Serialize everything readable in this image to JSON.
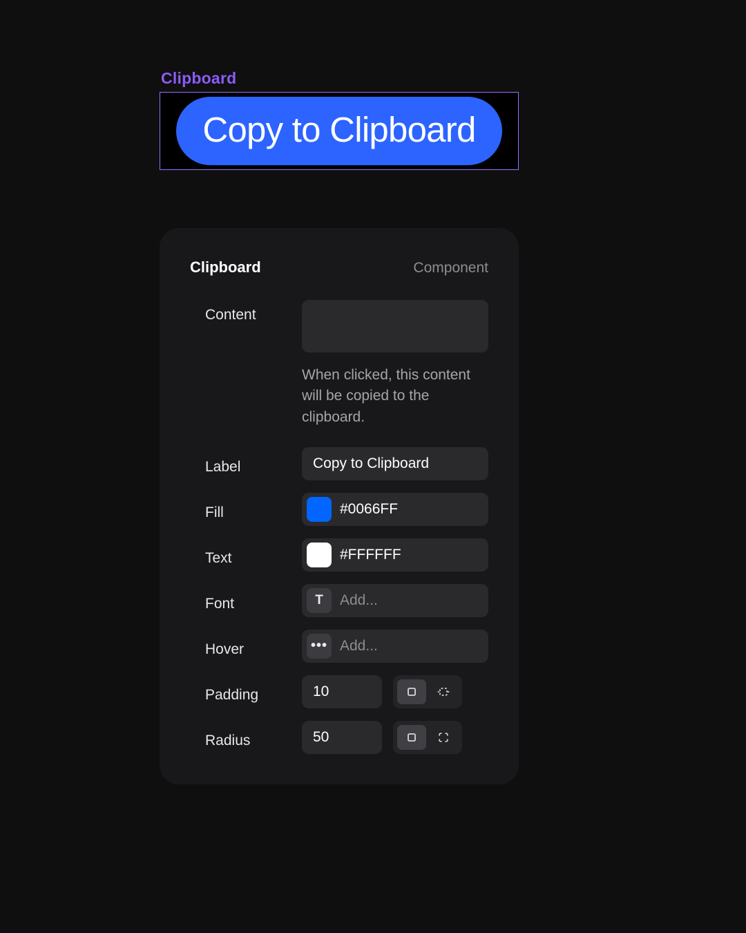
{
  "canvas": {
    "component_tag": "Clipboard",
    "button_label": "Copy to Clipboard",
    "button_fill": "#2d64ff",
    "button_text_color": "#ffffff"
  },
  "panel": {
    "title": "Clipboard",
    "subtitle": "Component",
    "content": {
      "label": "Content",
      "value": "",
      "help": "When clicked, this content will be copied to the clipboard."
    },
    "label_field": {
      "label": "Label",
      "value": "Copy to Clipboard"
    },
    "fill": {
      "label": "Fill",
      "value": "#0066FF"
    },
    "text": {
      "label": "Text",
      "value": "#FFFFFF"
    },
    "font": {
      "label": "Font",
      "placeholder": "Add..."
    },
    "hover": {
      "label": "Hover",
      "placeholder": "Add..."
    },
    "padding": {
      "label": "Padding",
      "value": "10"
    },
    "radius": {
      "label": "Radius",
      "value": "50"
    }
  }
}
